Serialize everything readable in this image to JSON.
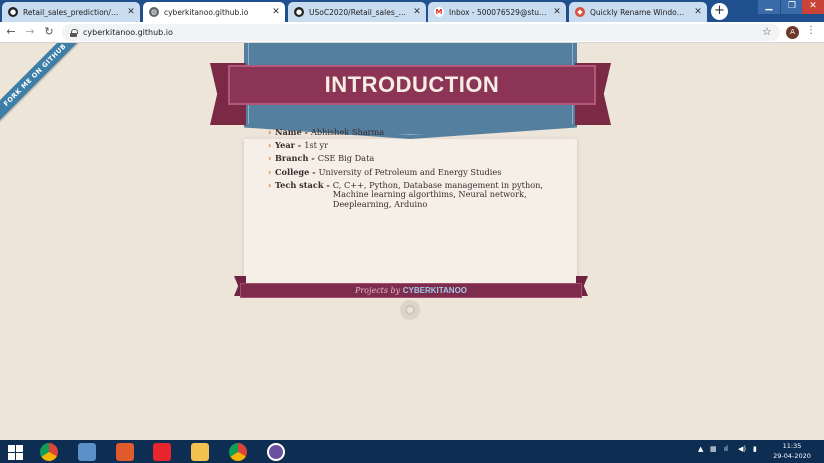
{
  "browser": {
    "tabs": [
      {
        "title": "Retail_sales_prediction/screensh",
        "favicon": "github-icon",
        "active": false
      },
      {
        "title": "cyberkitanoo.github.io",
        "favicon": "globe-icon",
        "active": true
      },
      {
        "title": "USoC2020/Retail_sales_predictio",
        "favicon": "github-icon",
        "active": false
      },
      {
        "title": "Inbox - 500076529@stu.upes.ac",
        "favicon": "gmail-icon",
        "active": false
      },
      {
        "title": "Quickly Rename Windows Files",
        "favicon": "site-icon",
        "active": false
      }
    ],
    "new_tab": "+",
    "url": "cyberkitanoo.github.io",
    "profile_initial": "A"
  },
  "page": {
    "fork_ribbon": "FORK ME ON GITHUB",
    "heading": "INTRODUCTION",
    "info": [
      {
        "label": "Name -",
        "value": "Abhishek Sharma"
      },
      {
        "label": "Year -",
        "value": "1st yr"
      },
      {
        "label": "Branch -",
        "value": "CSE Big Data"
      },
      {
        "label": "College -",
        "value": "University of Petroleum and Energy Studies"
      },
      {
        "label": "Tech stack -",
        "value": "C, C++, Python, Database management in python, Machine learning algorthims, Neural network, Deeplearning, Arduino"
      }
    ],
    "footer_prefix": "Projects by",
    "footer_name": "CYBERKITANOO"
  },
  "taskbar": {
    "time": "11:35",
    "date": "29-04-2020"
  },
  "colors": {
    "ribbon": "#8b3455",
    "panel": "#557f9f",
    "background": "#ede4da"
  }
}
